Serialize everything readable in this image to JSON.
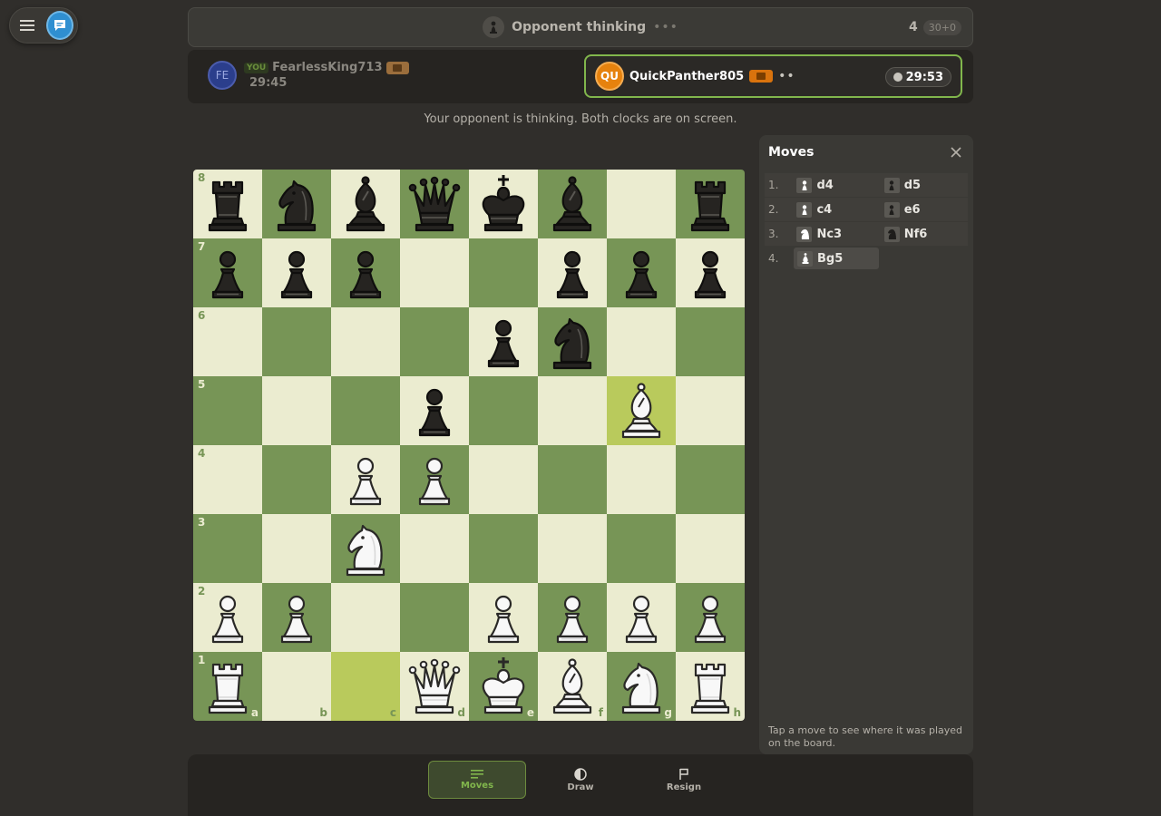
{
  "header": {
    "status": "Opponent thinking",
    "move_number": "4",
    "time_control": "30+0"
  },
  "players": {
    "you": {
      "avatar": "FE",
      "tag": "YOU",
      "name": "FearlessKing713",
      "clock": "29:45"
    },
    "opponent": {
      "avatar": "QU",
      "name": "QuickPanther805",
      "clock": "29:53"
    }
  },
  "note": "Your opponent is thinking. Both clocks are on screen.",
  "board": {
    "ranks": [
      "8",
      "7",
      "6",
      "5",
      "4",
      "3",
      "2",
      "1"
    ],
    "files": [
      "a",
      "b",
      "c",
      "d",
      "e",
      "f",
      "g",
      "h"
    ],
    "highlighted": [
      "c1",
      "g5"
    ],
    "position": {
      "a8": "bR",
      "b8": "bN",
      "c8": "bB",
      "d8": "bQ",
      "e8": "bK",
      "f8": "bB",
      "h8": "bR",
      "a7": "bP",
      "b7": "bP",
      "c7": "bP",
      "f7": "bP",
      "g7": "bP",
      "h7": "bP",
      "e6": "bP",
      "f6": "bN",
      "d5": "bP",
      "g5": "wB",
      "c4": "wP",
      "d4": "wP",
      "c3": "wN",
      "a2": "wP",
      "b2": "wP",
      "e2": "wP",
      "f2": "wP",
      "g2": "wP",
      "h2": "wP",
      "a1": "wR",
      "d1": "wQ",
      "e1": "wK",
      "f1": "wB",
      "g1": "wN",
      "h1": "wR"
    }
  },
  "moves_panel": {
    "title": "Moves",
    "moves": [
      {
        "num": "1.",
        "white": {
          "san": "d4",
          "piece": "pawn"
        },
        "black": {
          "san": "d5",
          "piece": "pawn"
        }
      },
      {
        "num": "2.",
        "white": {
          "san": "c4",
          "piece": "pawn"
        },
        "black": {
          "san": "e6",
          "piece": "pawn"
        }
      },
      {
        "num": "3.",
        "white": {
          "san": "Nc3",
          "piece": "knight"
        },
        "black": {
          "san": "Nf6",
          "piece": "knight"
        }
      },
      {
        "num": "4.",
        "white": {
          "san": "Bg5",
          "piece": "bishop"
        }
      }
    ],
    "hint": "Tap a move to see where it was played on the board."
  },
  "bottom_bar": {
    "moves_label": "Moves",
    "draw_label": "Draw",
    "resign_label": "Resign"
  },
  "colors": {
    "light_square": "#ebecd0",
    "dark_square": "#779556",
    "highlight": "#b9ca5c",
    "accent": "#81b64c"
  }
}
